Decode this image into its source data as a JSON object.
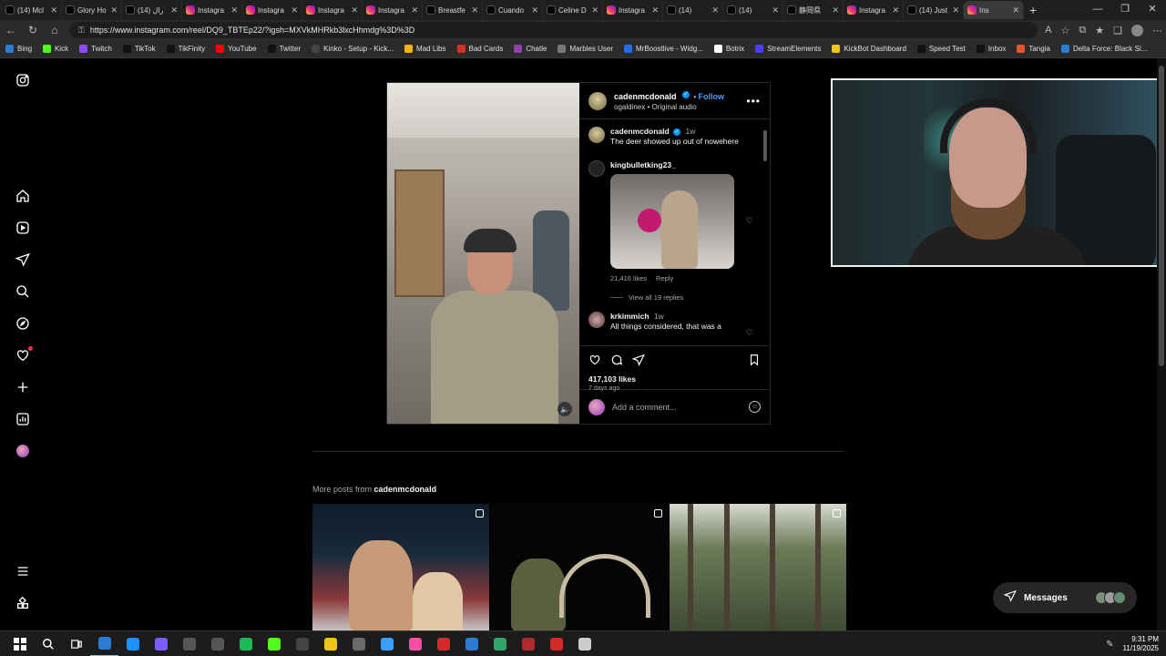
{
  "browser": {
    "tabs": [
      {
        "label": "(14) Mcl",
        "icon": "tiktok-icon",
        "favclass": "tt"
      },
      {
        "label": "Glory Ho",
        "icon": "tiktok-icon",
        "favclass": "tt"
      },
      {
        "label": "(14) رال",
        "icon": "tiktok-icon",
        "favclass": "tt"
      },
      {
        "label": "Instagra",
        "icon": "instagram-icon",
        "favclass": "ig"
      },
      {
        "label": "Instagra",
        "icon": "instagram-icon",
        "favclass": "ig"
      },
      {
        "label": "Instagra",
        "icon": "instagram-icon",
        "favclass": "ig"
      },
      {
        "label": "Instagra",
        "icon": "instagram-icon",
        "favclass": "ig"
      },
      {
        "label": "Breastfe",
        "icon": "tiktok-icon",
        "favclass": "tt"
      },
      {
        "label": "Cuando",
        "icon": "tiktok-icon",
        "favclass": "tt"
      },
      {
        "label": "Celine D",
        "icon": "tiktok-icon",
        "favclass": "tt"
      },
      {
        "label": "Instagra",
        "icon": "instagram-icon",
        "favclass": "ig"
      },
      {
        "label": "(14)",
        "icon": "tiktok-icon",
        "favclass": "tt"
      },
      {
        "label": "(14)",
        "icon": "tiktok-icon",
        "favclass": "tt"
      },
      {
        "label": "静岡県",
        "icon": "tiktok-icon",
        "favclass": "tt"
      },
      {
        "label": "Instagra",
        "icon": "instagram-icon",
        "favclass": "ig"
      },
      {
        "label": "(14) Just",
        "icon": "tiktok-icon",
        "favclass": "tt"
      },
      {
        "label": "Ins",
        "icon": "instagram-icon",
        "favclass": "ig",
        "active": true
      }
    ],
    "url": "https://www.instagram.com/reel/DQ9_TBTEp22/?igsh=MXVkMHRkb3lxcHhmdg%3D%3D",
    "bookmarks": [
      {
        "label": "Bing",
        "color": "#2b7cd3"
      },
      {
        "label": "Kick",
        "color": "#53fc18"
      },
      {
        "label": "Twitch",
        "color": "#9146ff"
      },
      {
        "label": "TikTok",
        "color": "#111111"
      },
      {
        "label": "TikFinity",
        "color": "#111111"
      },
      {
        "label": "YouTube",
        "color": "#ff0000"
      },
      {
        "label": "Twitter",
        "color": "#111111"
      },
      {
        "label": "Kinko - Setup - Kick...",
        "color": "#444444"
      },
      {
        "label": "Mad Libs",
        "color": "#f4b400"
      },
      {
        "label": "Bad Cards",
        "color": "#d93025"
      },
      {
        "label": "Chatle",
        "color": "#8e44ad"
      },
      {
        "label": "Marbles User",
        "color": "#777777"
      },
      {
        "label": "MrBoostlive - Widg...",
        "color": "#1f6feb"
      },
      {
        "label": "Botrix",
        "color": "#ffffff"
      },
      {
        "label": "StreamElements",
        "color": "#4b3bff"
      },
      {
        "label": "KickBot Dashboard",
        "color": "#f0c419"
      },
      {
        "label": "Speed Test",
        "color": "#111111"
      },
      {
        "label": "Inbox",
        "color": "#111111"
      },
      {
        "label": "Tangia",
        "color": "#e8542f"
      },
      {
        "label": "Delta Force: Black Si...",
        "color": "#2b7cd3"
      }
    ]
  },
  "post": {
    "author": "cadenmcdonald",
    "follow_label": "Follow",
    "audio": "ogaldinex • Original audio",
    "caption_author": "cadenmcdonald",
    "caption_time": "1w",
    "caption": "The deer showed up out of nowehere",
    "comment1_author": "kingbulletking23_",
    "comment1_likes": "21,416 likes",
    "comment1_reply": "Reply",
    "view_replies": "View all 19 replies",
    "comment2_author": "krkimmich",
    "comment2_time": "1w",
    "comment2_text": "All things considered, that was a",
    "likes": "417,103 likes",
    "ago": "7 days ago",
    "comment_placeholder": "Add a comment..."
  },
  "more_posts": {
    "prefix": "More posts from",
    "author": "cadenmcdonald"
  },
  "messages": {
    "label": "Messages"
  },
  "taskbar": {
    "time": "9:31 PM",
    "date": "11/19/2025",
    "apps": [
      "#2b7cd3",
      "#1e90ff",
      "#7a5cff",
      "#555555",
      "#555555",
      "#1db954",
      "#53fc18",
      "#444444",
      "#f0c419",
      "#6a6a6a",
      "#3aa0ff",
      "#ff4fa0",
      "#d42a2a",
      "#2b7cd3",
      "#2fa56a",
      "#b02a30",
      "#d42a2a",
      "#cccccc"
    ]
  }
}
